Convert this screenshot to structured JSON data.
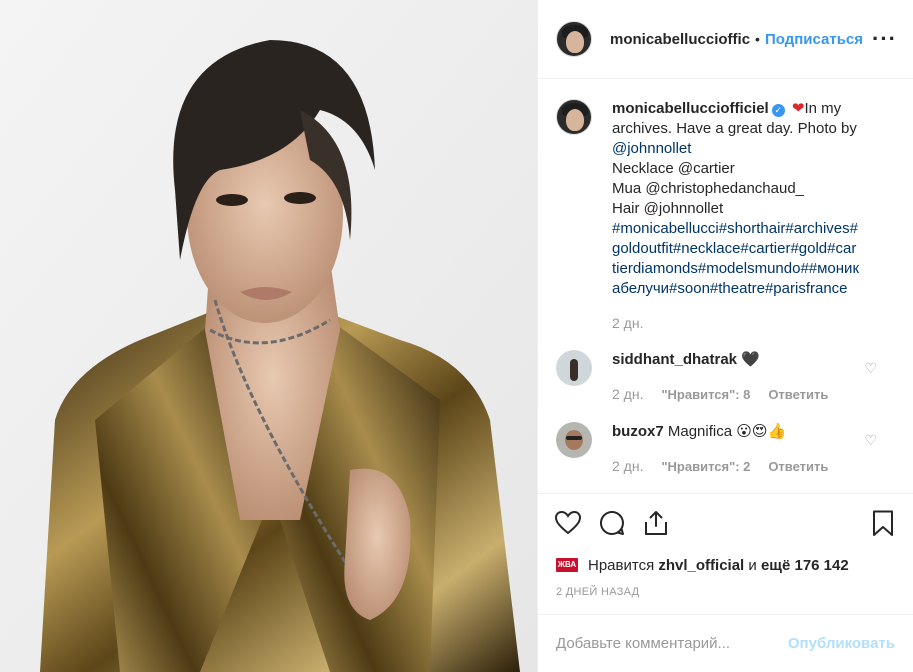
{
  "header": {
    "username": "monicabellucciofficiel",
    "username_display": "monicabelluccioffic",
    "dot": "•",
    "follow": "Подписаться",
    "more": "•••"
  },
  "caption": {
    "username": "monicabellucciofficiel",
    "verified_mark": "✓",
    "heart": "❤",
    "lines": [
      "In my",
      "archives. Have a great day. Photo by",
      "@johnnollet",
      "Necklace @cartier",
      "Mua @christophedanchaud_",
      "Hair @johnnollet",
      "#monicabellucci#shorthair#archives#",
      "goldoutfit#necklace#cartier#gold#car",
      "tierdiamonds#modelsmundo##моник",
      "абелучи#soon#theatre#parisfrance"
    ],
    "time": "2 дн."
  },
  "comments": [
    {
      "username": "siddhant_dhatrak",
      "text": "🖤",
      "time": "2 дн.",
      "likes": "\"Нравится\": 8",
      "reply": "Ответить"
    },
    {
      "username": "buzox7",
      "text": "Magnifica 😮😍👍",
      "time": "2 дн.",
      "likes": "\"Нравится\": 2",
      "reply": "Ответить"
    }
  ],
  "likes": {
    "avatar_text": "ЖВА",
    "prefix": "Нравится",
    "user": "zhvl_official",
    "and": "и",
    "count": "ещё 176 142"
  },
  "date": "2 ДНЕЙ НАЗАД",
  "add_comment": {
    "placeholder": "Добавьте комментарий...",
    "publish": "Опубликовать"
  },
  "colors": {
    "accent": "#3897f0",
    "publish_disabled": "#b2dffc",
    "muted": "#999999",
    "heart": "#e0262d"
  }
}
